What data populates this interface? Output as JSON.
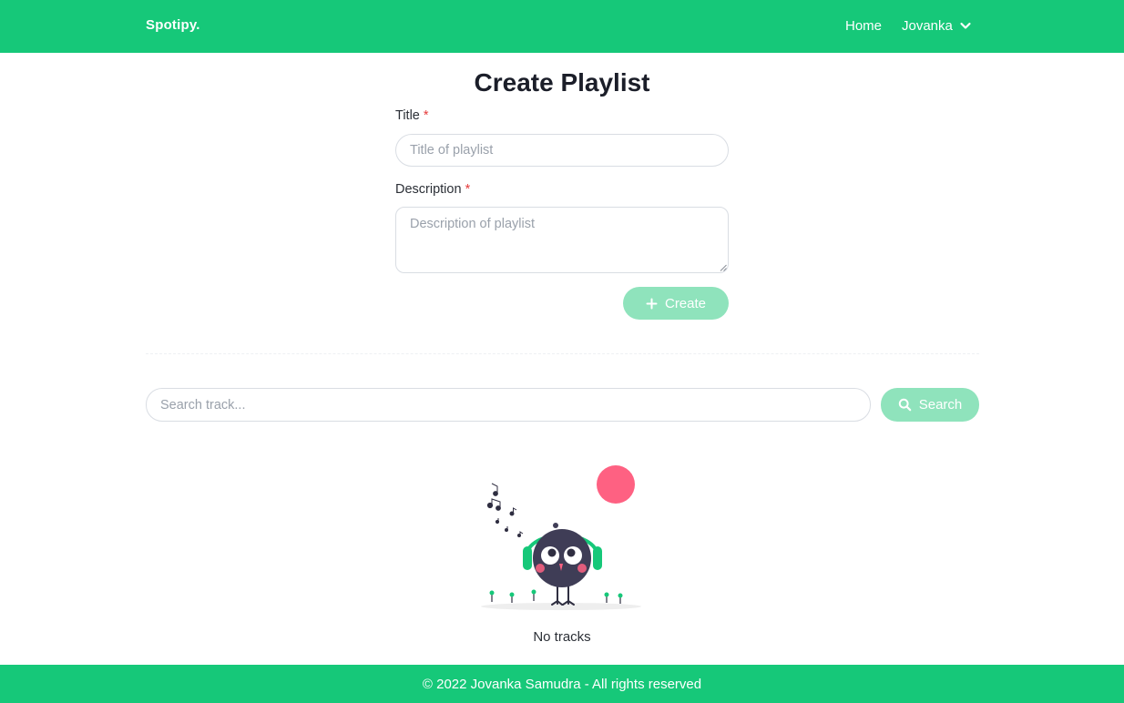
{
  "navbar": {
    "brand": "Spotipy.",
    "home_label": "Home",
    "user_label": "Jovanka"
  },
  "form": {
    "heading": "Create Playlist",
    "title_label": "Title",
    "required_mark": "*",
    "title_placeholder": "Title of playlist",
    "title_value": "",
    "description_label": "Description",
    "description_placeholder": "Description of playlist",
    "description_value": "",
    "create_label": "Create"
  },
  "search": {
    "placeholder": "Search track...",
    "value": "",
    "button_label": "Search"
  },
  "tracks": {
    "empty_text": "No tracks"
  },
  "footer": {
    "text": "© 2022 Jovanka Samudra - All rights reserved"
  },
  "colors": {
    "brand_green": "#16c879",
    "button_disabled_green": "#8fe3bc",
    "required_red": "#e53b3b",
    "accent_pink": "#fe6182"
  },
  "icons": {
    "user_menu": "chevron-down-icon",
    "create": "plus-icon",
    "search": "search-icon"
  }
}
